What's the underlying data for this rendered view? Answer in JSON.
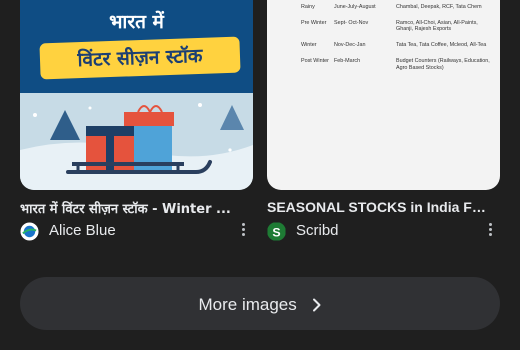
{
  "results": [
    {
      "image_heading_line1": "भारत में",
      "image_heading_line2": "विंटर सीज़न स्टॉक",
      "title": "भारत में विंटर सीज़न स्टॉक - Winter ...",
      "source": "Alice Blue",
      "source_icon": "alice-blue-logo-icon",
      "accent": "#0f4d84"
    },
    {
      "doc_rows": [
        [
          "Rainy",
          "June-July-August",
          "Chambal, Deepak, RCF, Tata Chem",
          ""
        ],
        [
          "Pre Winter",
          "Sept- Oct-Nov",
          "Ramco, All-Choi, Asian, All-Paints, Ghanji, Rajesh Exports",
          ""
        ],
        [
          "Winter",
          "Nov-Dec-Jan",
          "Tata Tea, Tata Coffee, Mcleod, All-Tea",
          ""
        ],
        [
          "Post Winter",
          "Feb-March",
          "Budget Counters (Railways, Education, Agro Based Stocks)",
          ""
        ]
      ],
      "title": "SEASONAL STOCKS in India For...",
      "source": "Scribd",
      "source_icon": "scribd-logo-icon",
      "accent": "#1e7b34"
    }
  ],
  "more_images": {
    "label": "More images",
    "icon": "chevron-right-icon"
  },
  "colors": {
    "background": "#1f1f1f",
    "button_bg": "#303134",
    "text": "#e8eaed"
  }
}
